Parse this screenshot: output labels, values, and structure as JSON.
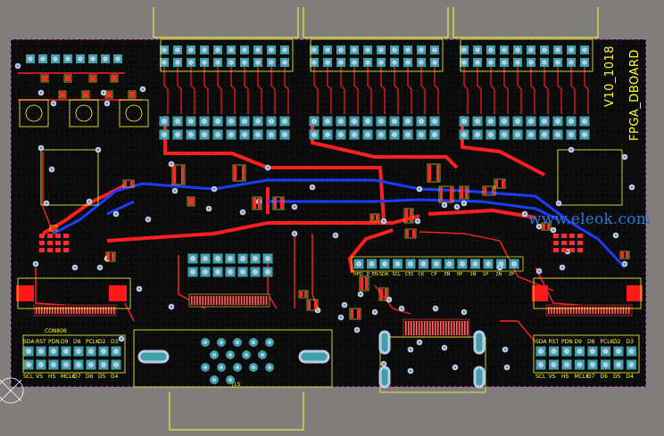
{
  "board": {
    "version": "V10_1018",
    "name": "FPGA_DBOARD",
    "watermark": "www.eleok.com",
    "connector_label": "CON806",
    "port_label": "J15",
    "left_port_top_row": [
      "SDA",
      "RST",
      "PDN",
      "D9",
      "D8",
      "PCLK",
      "D2",
      "D3"
    ],
    "left_port_bottom_row": [
      "SCL",
      "VS",
      "HS",
      "MCLK",
      "D7",
      "D6",
      "D5",
      "D4"
    ],
    "right_port_top_row": [
      "SDA",
      "RST",
      "PDN",
      "D9",
      "D8",
      "PCLK",
      "D2",
      "D3"
    ],
    "right_port_bottom_row": [
      "SCL",
      "VS",
      "HS",
      "MCLK",
      "D7",
      "D6",
      "D5",
      "D4"
    ],
    "mid_header_labels": [
      "HPD",
      "D_EN",
      "SDA",
      "SCL",
      "CEC",
      "CK",
      "CP",
      "0N",
      "0P",
      "1N",
      "1P",
      "2N",
      "2P"
    ],
    "colors": {
      "board": "#0b0b0b",
      "background": "#807d7a",
      "silkscreen": "#ffff33",
      "top_copper": "#ff1f1f",
      "bottom_copper": "#1c3cff",
      "pad": "#3fa0a8",
      "drill": "#b9cbe8",
      "outline": "#cc66cc"
    }
  }
}
